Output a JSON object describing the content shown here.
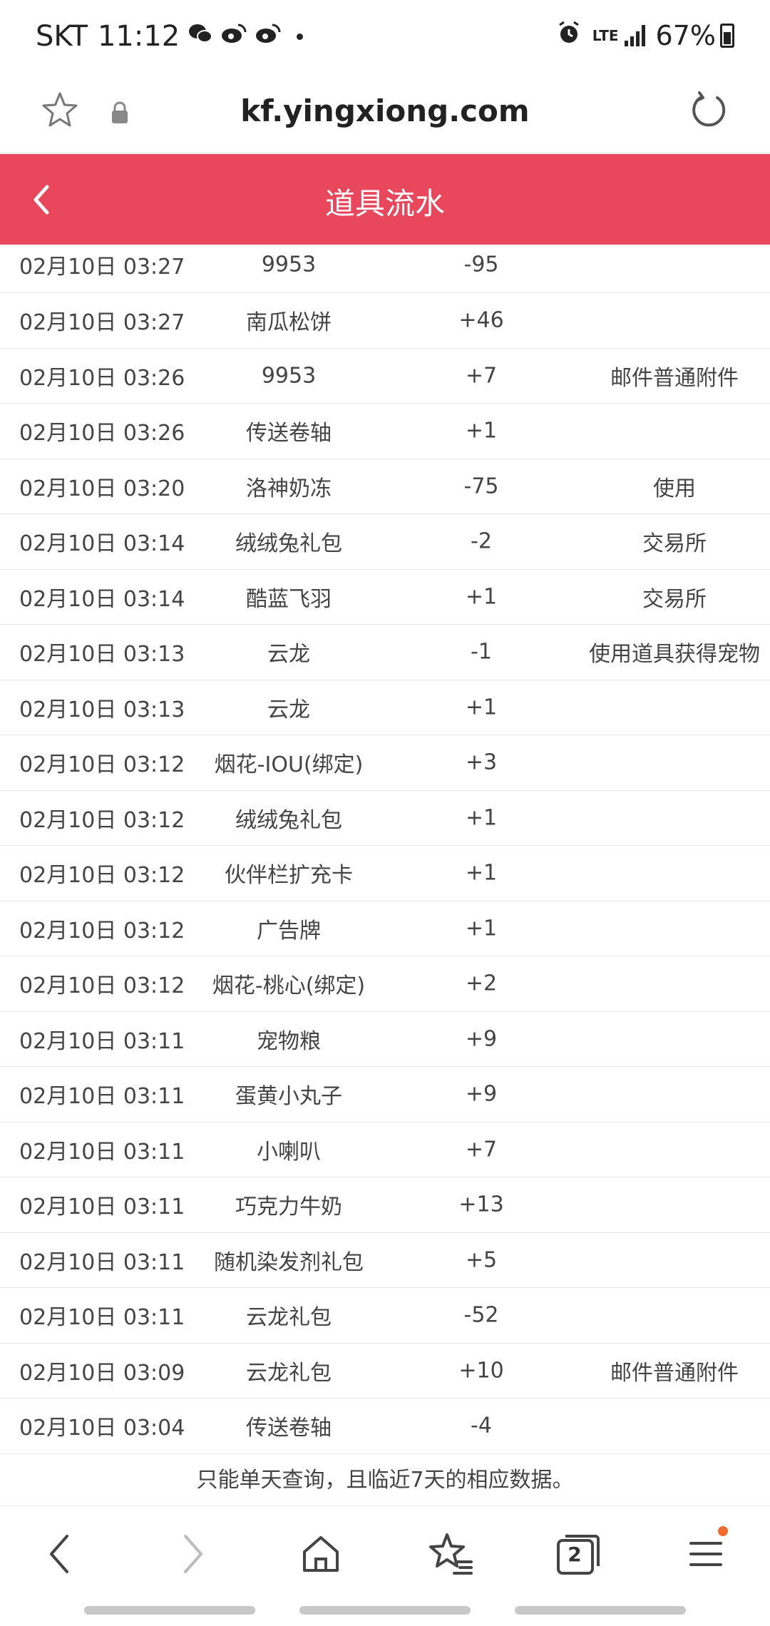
{
  "status_bar": {
    "carrier": "SKT",
    "time": "11:12",
    "network": "LTE",
    "battery": "67%"
  },
  "browser": {
    "url": "kf.yingxiong.com"
  },
  "header": {
    "title": "道具流水"
  },
  "records": [
    {
      "time": "02月10日 03:27",
      "item": "9953",
      "qty": "-95",
      "source": ""
    },
    {
      "time": "02月10日 03:27",
      "item": "南瓜松饼",
      "qty": "+46",
      "source": ""
    },
    {
      "time": "02月10日 03:26",
      "item": "9953",
      "qty": "+7",
      "source": "邮件普通附件"
    },
    {
      "time": "02月10日 03:26",
      "item": "传送卷轴",
      "qty": "+1",
      "source": ""
    },
    {
      "time": "02月10日 03:20",
      "item": "洛神奶冻",
      "qty": "-75",
      "source": "使用"
    },
    {
      "time": "02月10日 03:14",
      "item": "绒绒兔礼包",
      "qty": "-2",
      "source": "交易所"
    },
    {
      "time": "02月10日 03:14",
      "item": "酷蓝飞羽",
      "qty": "+1",
      "source": "交易所"
    },
    {
      "time": "02月10日 03:13",
      "item": "云龙",
      "qty": "-1",
      "source": "使用道具获得宠物"
    },
    {
      "time": "02月10日 03:13",
      "item": "云龙",
      "qty": "+1",
      "source": ""
    },
    {
      "time": "02月10日 03:12",
      "item": "烟花-IOU(绑定)",
      "qty": "+3",
      "source": ""
    },
    {
      "time": "02月10日 03:12",
      "item": "绒绒兔礼包",
      "qty": "+1",
      "source": ""
    },
    {
      "time": "02月10日 03:12",
      "item": "伙伴栏扩充卡",
      "qty": "+1",
      "source": ""
    },
    {
      "time": "02月10日 03:12",
      "item": "广告牌",
      "qty": "+1",
      "source": ""
    },
    {
      "time": "02月10日 03:12",
      "item": "烟花-桃心(绑定)",
      "qty": "+2",
      "source": ""
    },
    {
      "time": "02月10日 03:11",
      "item": "宠物粮",
      "qty": "+9",
      "source": ""
    },
    {
      "time": "02月10日 03:11",
      "item": "蛋黄小丸子",
      "qty": "+9",
      "source": ""
    },
    {
      "time": "02月10日 03:11",
      "item": "小喇叭",
      "qty": "+7",
      "source": ""
    },
    {
      "time": "02月10日 03:11",
      "item": "巧克力牛奶",
      "qty": "+13",
      "source": ""
    },
    {
      "time": "02月10日 03:11",
      "item": "随机染发剂礼包",
      "qty": "+5",
      "source": ""
    },
    {
      "time": "02月10日 03:11",
      "item": "云龙礼包",
      "qty": "-52",
      "source": ""
    },
    {
      "time": "02月10日 03:09",
      "item": "云龙礼包",
      "qty": "+10",
      "source": "邮件普通附件"
    },
    {
      "time": "02月10日 03:04",
      "item": "传送卷轴",
      "qty": "-4",
      "source": ""
    }
  ],
  "notice": "只能单天查询，且临近7天的相应数据。",
  "toolbar": {
    "tabs_count": "2"
  },
  "colors": {
    "header_bg": "#e8475c",
    "menu_badge": "#f26b2d"
  }
}
